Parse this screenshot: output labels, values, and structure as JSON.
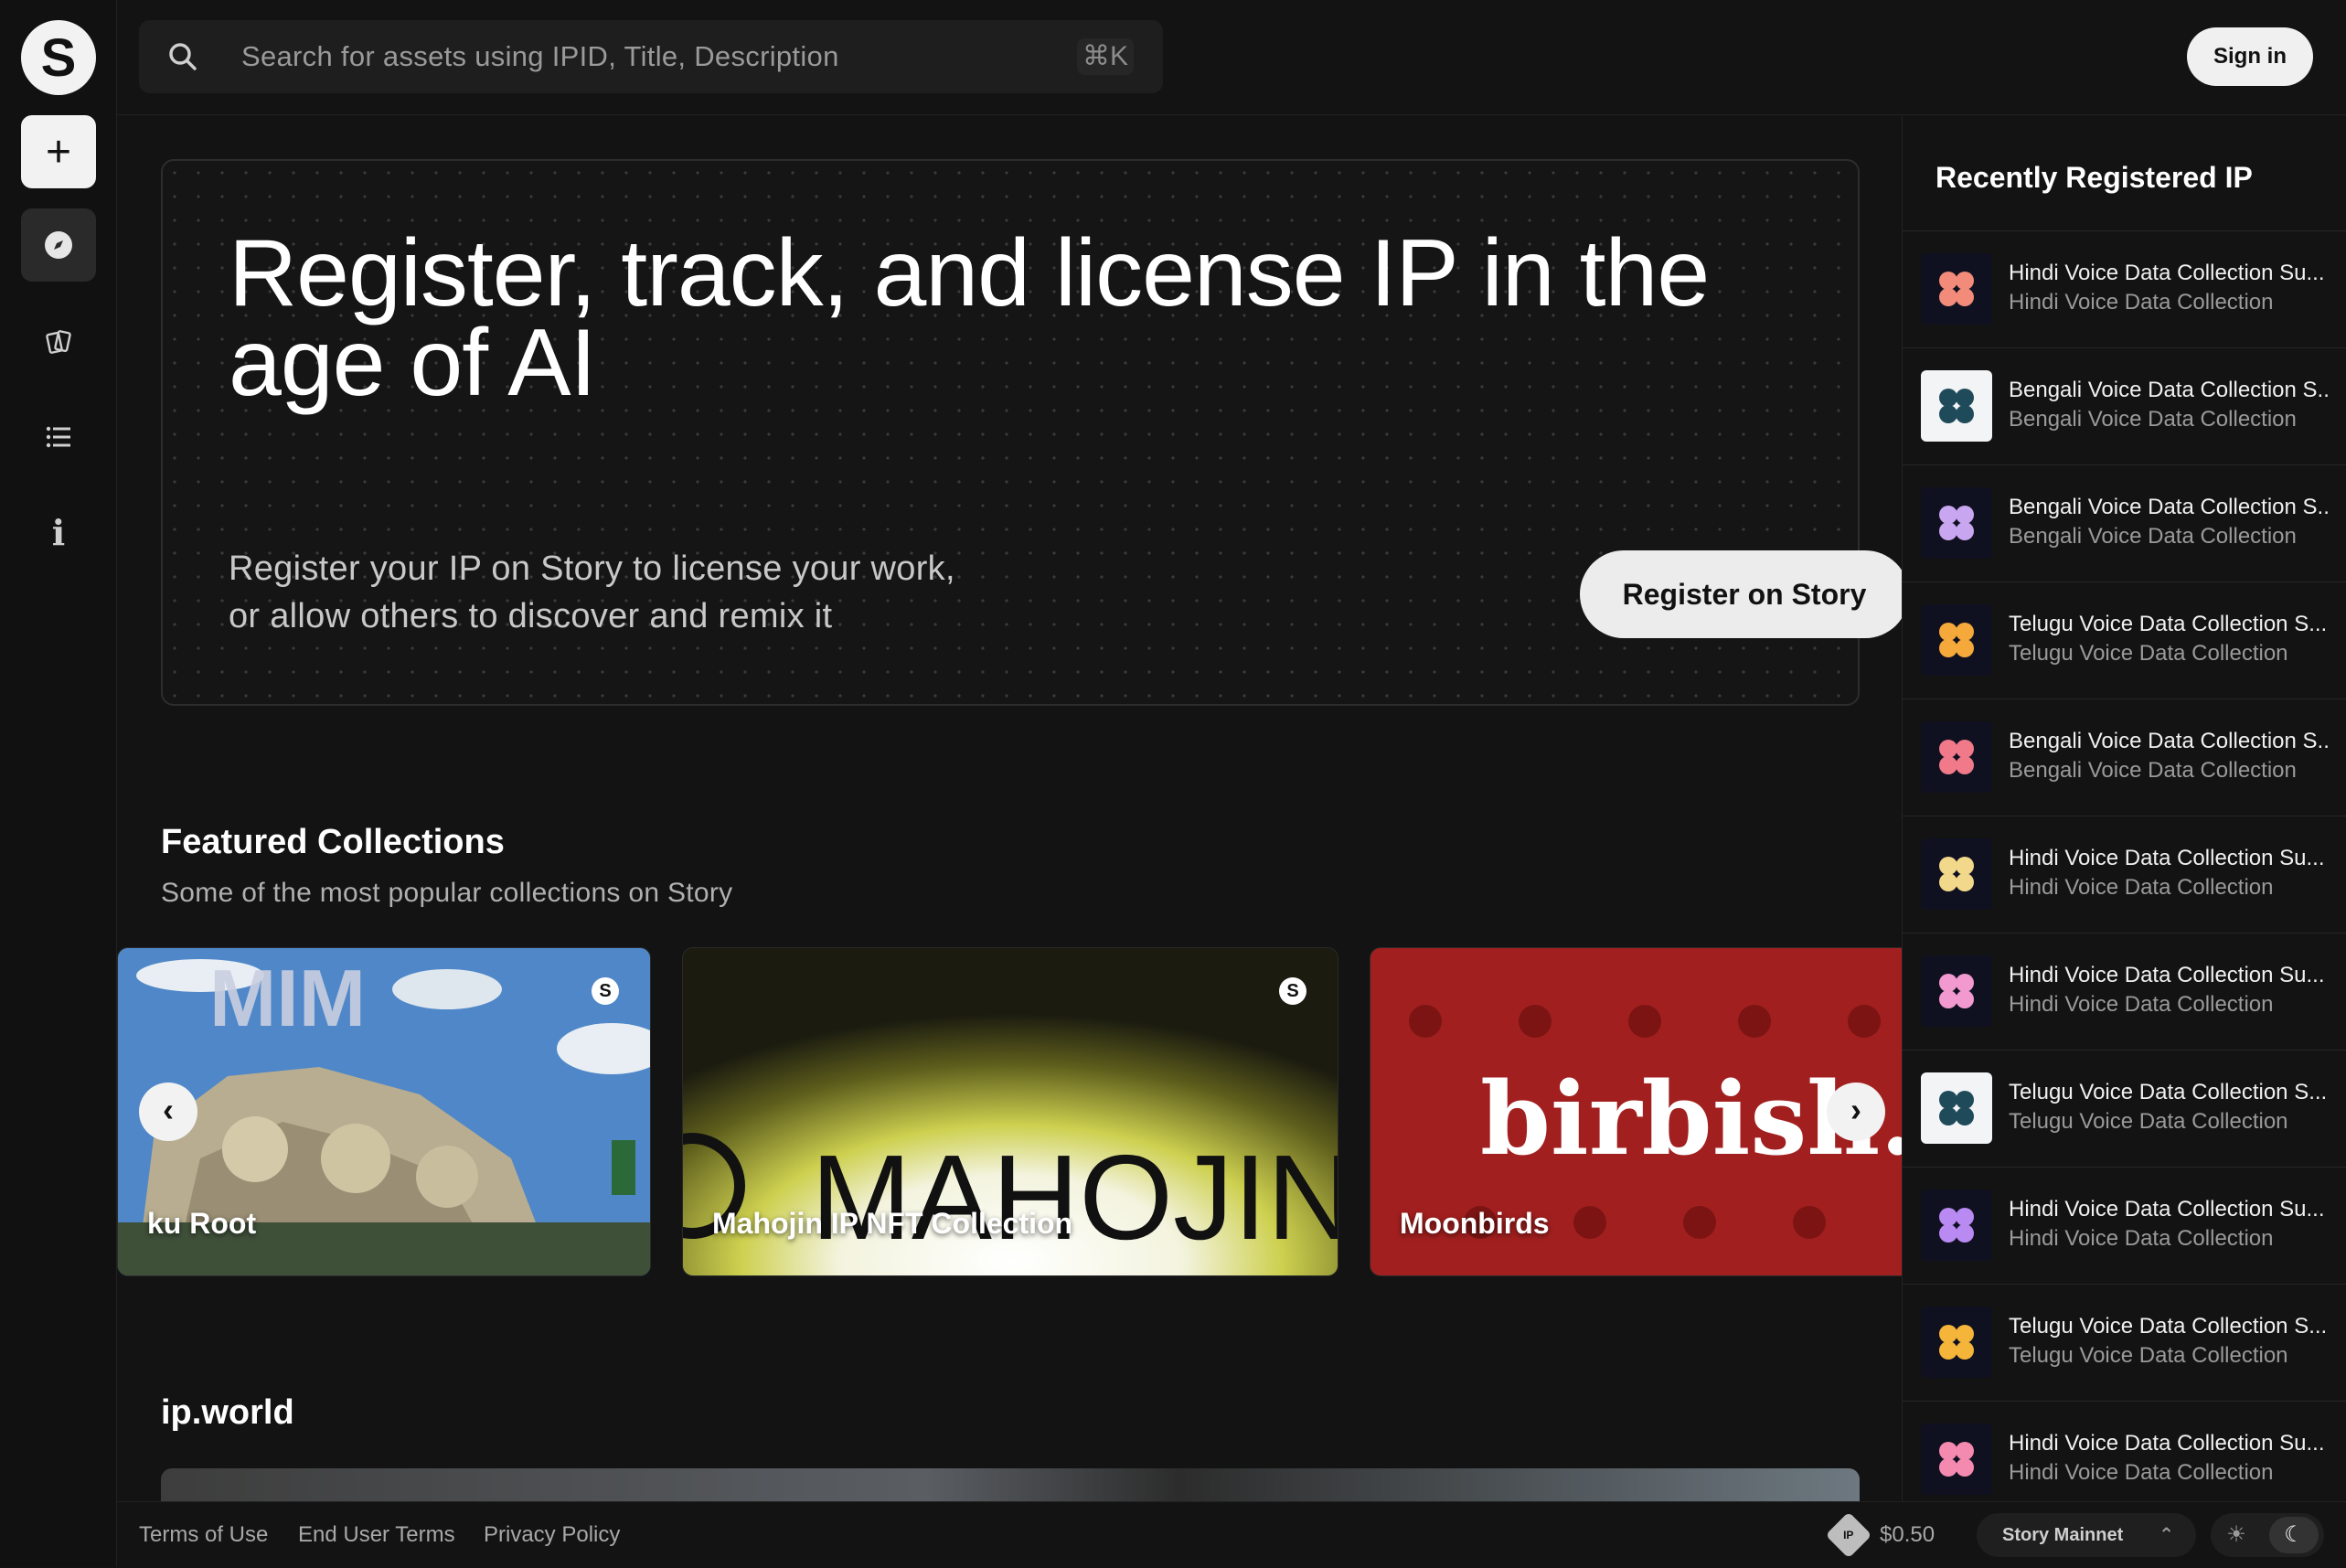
{
  "sidebar": {
    "logo_letter": "S",
    "add_label": "+",
    "info_label": "i"
  },
  "search": {
    "placeholder": "Search for assets using IPID, Title, Description",
    "shortcut": "⌘K"
  },
  "header": {
    "sign_in_label": "Sign in"
  },
  "hero": {
    "title": "Register, track, and license IP in the age of AI",
    "subtitle_line1": "Register your IP on Story to license your work,",
    "subtitle_line2": "or allow others to discover and remix it",
    "cta_label": "Register on Story"
  },
  "featured": {
    "title": "Featured Collections",
    "subtitle": "Some of the most popular collections on Story",
    "cards": [
      {
        "label": "ku Root",
        "badge": "S"
      },
      {
        "label": "Mahojin IP NFT Collection",
        "badge": "S"
      },
      {
        "label": "Moonbirds"
      }
    ],
    "prev_label": "‹",
    "next_label": "›"
  },
  "ipworld": {
    "title": "ip.world"
  },
  "recent": {
    "title": "Recently Registered IP",
    "items": [
      {
        "name": "Hindi Voice Data Collection Su...",
        "collection": "Hindi Voice Data Collection",
        "thumb": "dark",
        "accent": "#f28b7a"
      },
      {
        "name": "Bengali Voice Data Collection S...",
        "collection": "Bengali Voice Data Collection",
        "thumb": "light",
        "accent": "#1f4a5a"
      },
      {
        "name": "Bengali Voice Data Collection S...",
        "collection": "Bengali Voice Data Collection",
        "thumb": "dark",
        "accent": "#c9a6f0"
      },
      {
        "name": "Telugu Voice Data Collection S...",
        "collection": "Telugu Voice Data Collection",
        "thumb": "dark",
        "accent": "#f5a93a"
      },
      {
        "name": "Bengali Voice Data Collection S...",
        "collection": "Bengali Voice Data Collection",
        "thumb": "dark",
        "accent": "#f07a8a"
      },
      {
        "name": "Hindi Voice Data Collection Su...",
        "collection": "Hindi Voice Data Collection",
        "thumb": "dark",
        "accent": "#f2d88a"
      },
      {
        "name": "Hindi Voice Data Collection Su...",
        "collection": "Hindi Voice Data Collection",
        "thumb": "dark",
        "accent": "#f29ad0"
      },
      {
        "name": "Telugu Voice Data Collection S...",
        "collection": "Telugu Voice Data Collection",
        "thumb": "light",
        "accent": "#1f4a5a"
      },
      {
        "name": "Hindi Voice Data Collection Su...",
        "collection": "Hindi Voice Data Collection",
        "thumb": "dark",
        "accent": "#b98af2"
      },
      {
        "name": "Telugu Voice Data Collection S...",
        "collection": "Telugu Voice Data Collection",
        "thumb": "dark",
        "accent": "#f5b53a"
      },
      {
        "name": "Hindi Voice Data Collection Su...",
        "collection": "Hindi Voice Data Collection",
        "thumb": "dark",
        "accent": "#f58ab0"
      }
    ]
  },
  "footer": {
    "terms": "Terms of Use",
    "end_user_terms": "End User Terms",
    "privacy": "Privacy Policy",
    "coin": "IP",
    "price": "$0.50",
    "network": "Story Mainnet"
  }
}
